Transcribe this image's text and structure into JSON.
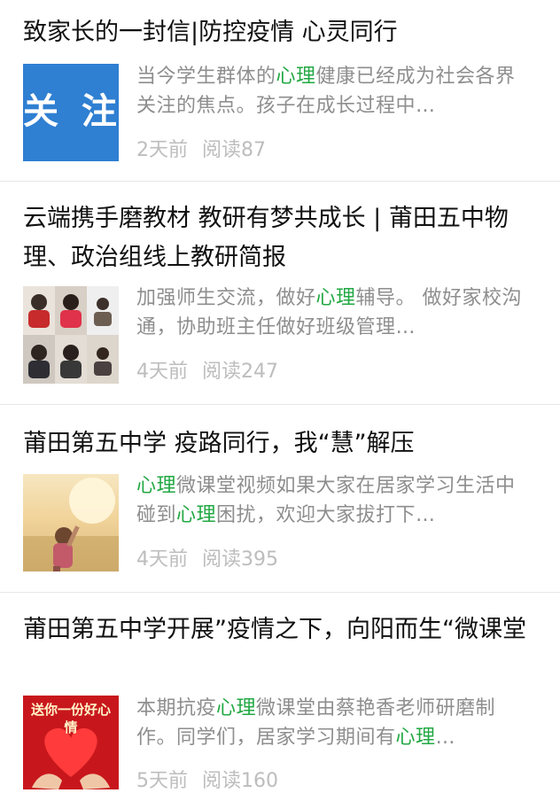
{
  "articles": [
    {
      "title": "致家长的一封信|防控疫情 心灵同行",
      "thumb_text": "关 注",
      "snippet_parts": [
        {
          "t": "当今学生群体的",
          "hl": false
        },
        {
          "t": "心理",
          "hl": true
        },
        {
          "t": "健康已经成为社会各界关注的焦点。孩子在成长过程中…",
          "hl": false
        }
      ],
      "age": "2天前",
      "reads": "阅读87"
    },
    {
      "title": "云端携手磨教材 教研有梦共成长 | 莆田五中物理、政治组线上教研简报",
      "snippet_parts": [
        {
          "t": "加强师生交流，做好",
          "hl": false
        },
        {
          "t": "心理",
          "hl": true
        },
        {
          "t": "辅导。 做好家校沟通，协助班主任做好班级管理…",
          "hl": false
        }
      ],
      "age": "4天前",
      "reads": "阅读247"
    },
    {
      "title": "莆田第五中学 疫路同行，我“慧”解压",
      "snippet_parts": [
        {
          "t": "心理",
          "hl": true
        },
        {
          "t": "微课堂视频如果大家在居家学习生活中碰到",
          "hl": false
        },
        {
          "t": "心理",
          "hl": true
        },
        {
          "t": "困扰，欢迎大家拔打下…",
          "hl": false
        }
      ],
      "age": "4天前",
      "reads": "阅读395"
    },
    {
      "title": "莆田第五中学开展”疫情之下，向阳而生“微课堂",
      "thumb_text": "送你一份好心情",
      "snippet_parts": [
        {
          "t": "本期抗疫",
          "hl": false
        },
        {
          "t": "心理",
          "hl": true
        },
        {
          "t": "微课堂由蔡艳香老师研磨制作。同学们，居家学习期间有",
          "hl": false
        },
        {
          "t": "心理",
          "hl": true
        },
        {
          "t": "…",
          "hl": false
        }
      ],
      "age": "5天前",
      "reads": "阅读160"
    }
  ],
  "colors": {
    "highlight": "#22a843",
    "snippet": "#8e8e8e",
    "meta": "#bdbdbd"
  }
}
